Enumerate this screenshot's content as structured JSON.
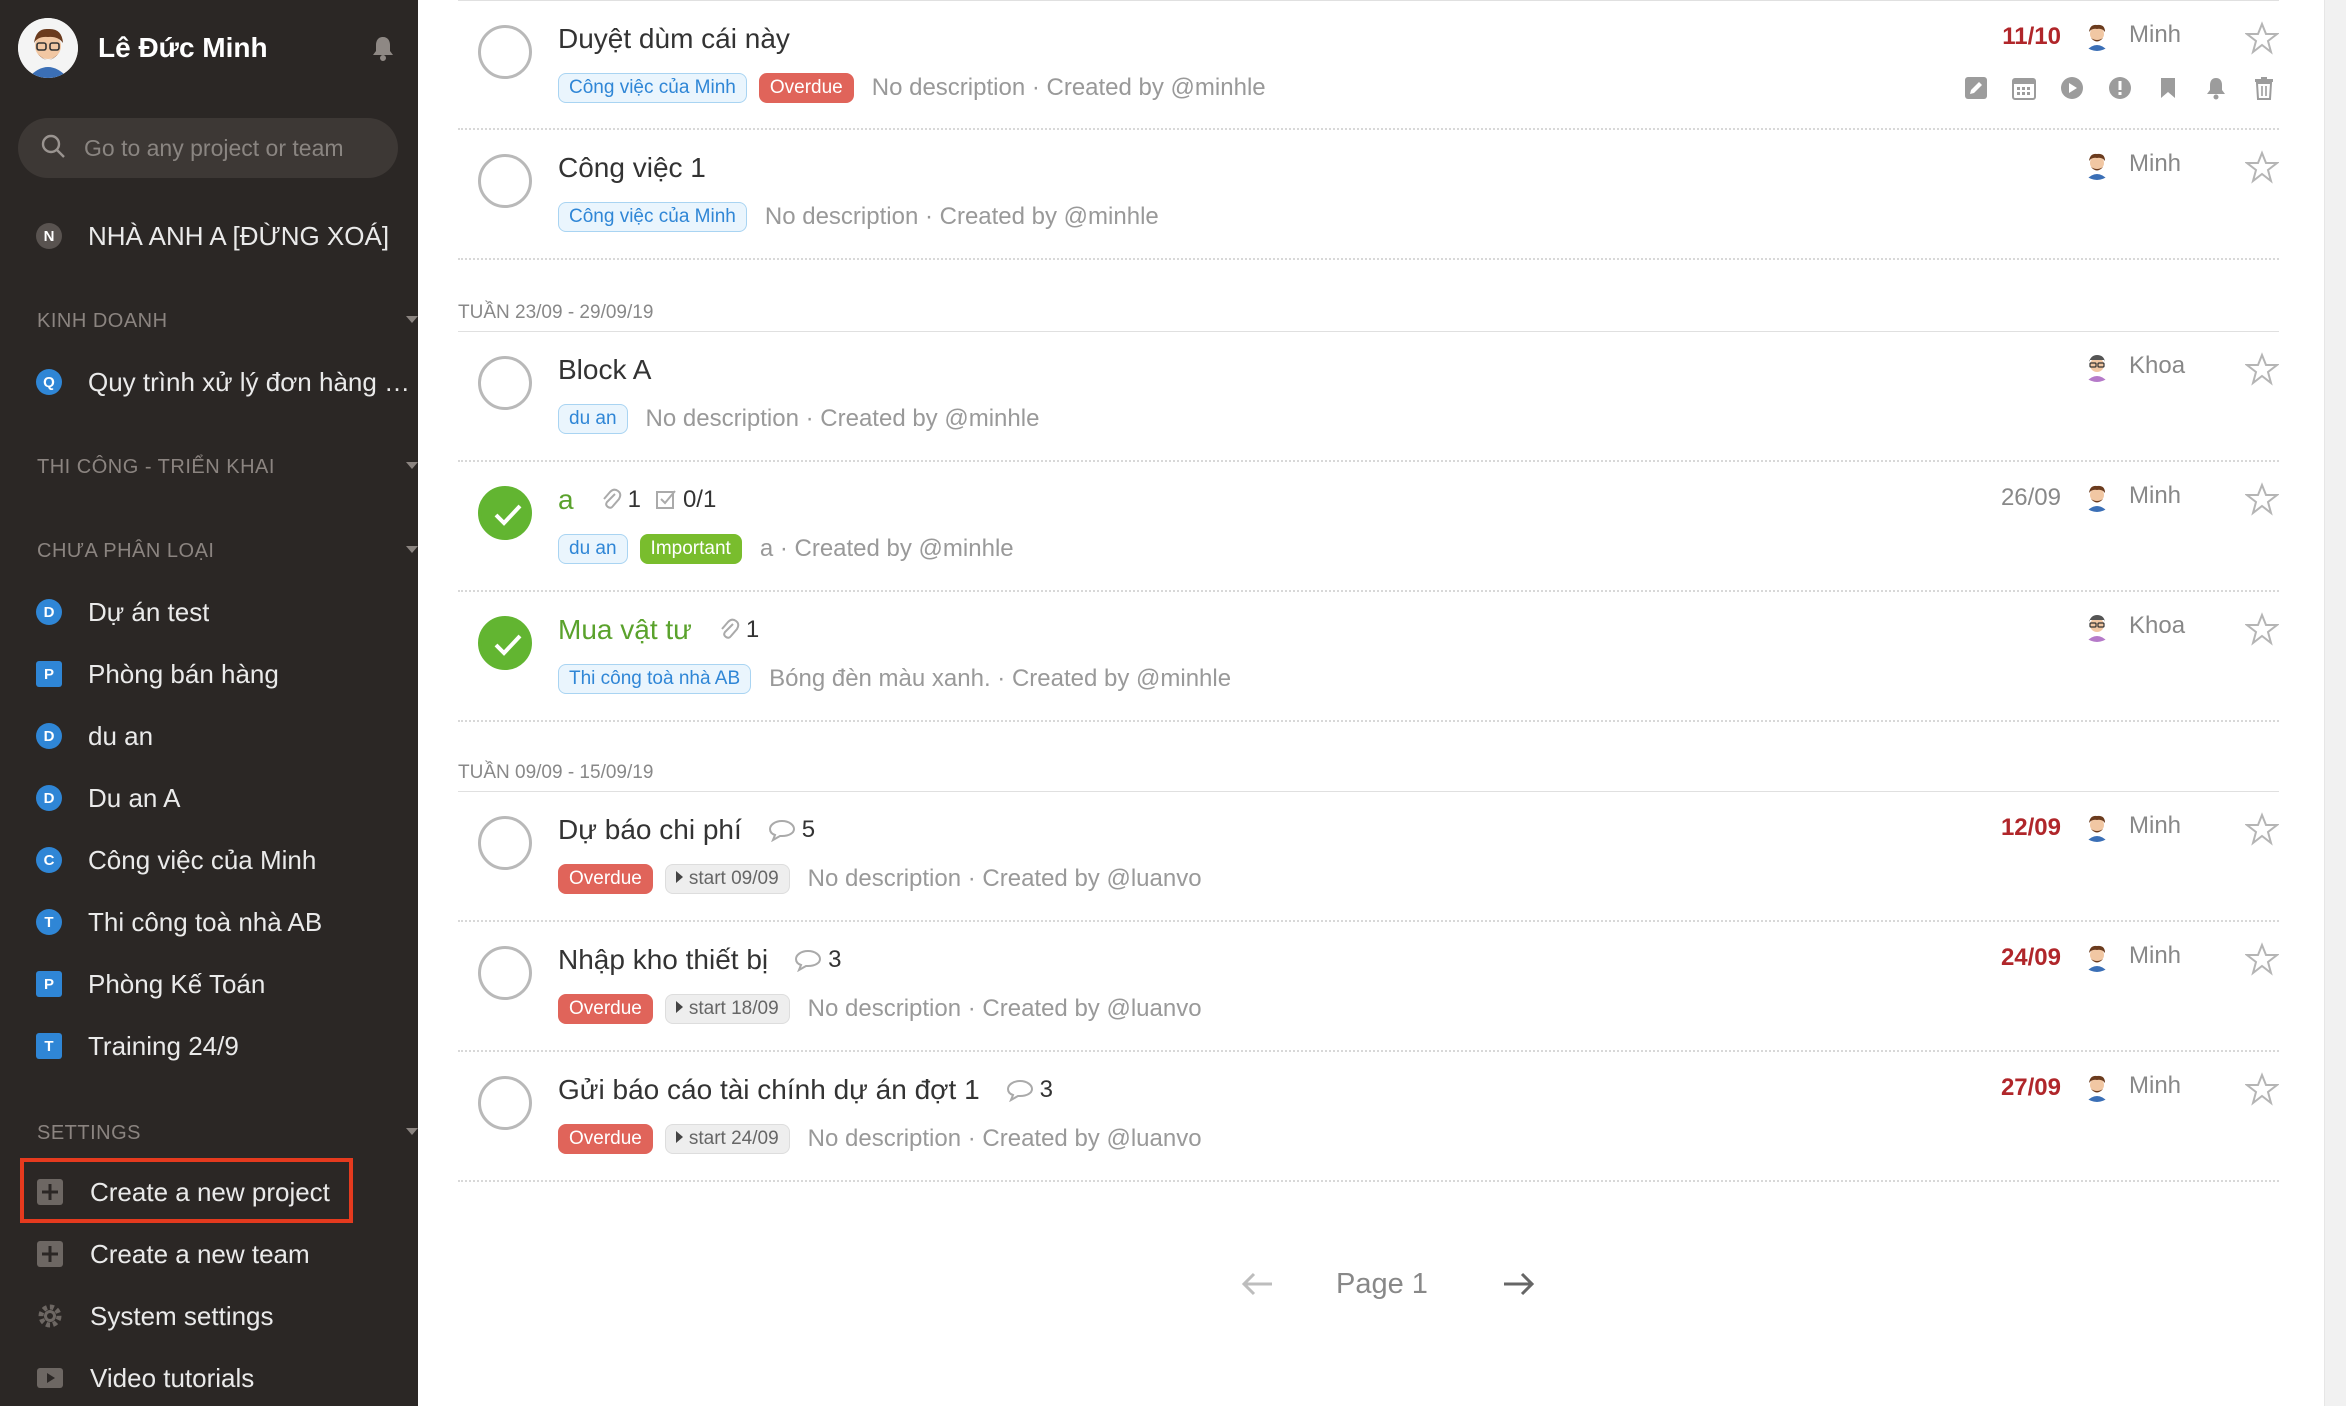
{
  "sidebar": {
    "user_name": "Lê Đức Minh",
    "search_placeholder": "Go to any project or team",
    "top_item": {
      "letter": "N",
      "label": "NHÀ ANH A [ĐỪNG XOÁ]"
    },
    "sections": [
      {
        "title": "KINH DOANH"
      },
      {
        "title": "THI CÔNG - TRIỂN KHAI"
      },
      {
        "title": "CHƯA PHÂN LOẠI"
      },
      {
        "title": "SETTINGS"
      }
    ],
    "kinh_doanh_items": [
      {
        "letter": "Q",
        "label": "Quy trình xử lý đơn hàng - Tr..."
      }
    ],
    "uncategorized_items": [
      {
        "letter": "D",
        "label": "Dự án test"
      },
      {
        "letter": "P",
        "label": "Phòng bán hàng"
      },
      {
        "letter": "D",
        "label": "du an"
      },
      {
        "letter": "D",
        "label": "Du an A"
      },
      {
        "letter": "C",
        "label": "Công việc của Minh"
      },
      {
        "letter": "T",
        "label": "Thi công toà nhà AB"
      },
      {
        "letter": "P",
        "label": "Phòng Kế Toán"
      },
      {
        "letter": "T",
        "label": "Training 24/9"
      }
    ],
    "settings_items": [
      {
        "icon": "plus-square-icon",
        "label": "Create a new project"
      },
      {
        "icon": "plus-square-icon",
        "label": "Create a new team"
      },
      {
        "icon": "gear-icon",
        "label": "System settings"
      },
      {
        "icon": "video-icon",
        "label": "Video tutorials"
      }
    ],
    "accent": "#2f86d6",
    "highlight_color": "#e53a1e"
  },
  "weeks": [
    {
      "label": "TUẦN 23/09 - 29/09/19"
    },
    {
      "label": "TUẦN 09/09 - 15/09/19"
    }
  ],
  "tasks": [
    {
      "title": "Duyệt dùm cái này",
      "done": false,
      "tags": [
        {
          "text": "Công việc của Minh",
          "style": "blue"
        },
        {
          "text": "Overdue",
          "style": "red"
        }
      ],
      "desc": "No description · Created by @minhle",
      "due": "11/10",
      "assignee": "Minh"
    },
    {
      "title": "Công việc 1",
      "done": false,
      "tags": [
        {
          "text": "Công việc của Minh",
          "style": "blue"
        }
      ],
      "desc": "No description · Created by @minhle",
      "due": "",
      "assignee": "Minh"
    },
    {
      "title": "Block A",
      "done": false,
      "tags": [
        {
          "text": "du an",
          "style": "blue"
        }
      ],
      "desc": "No description · Created by @minhle",
      "due": "",
      "assignee": "Khoa"
    },
    {
      "title": "a",
      "done": true,
      "attachments": "1",
      "checklist": "0/1",
      "tags": [
        {
          "text": "du an",
          "style": "blue"
        },
        {
          "text": "Important",
          "style": "green"
        }
      ],
      "desc": "a · Created by @minhle",
      "due": "26/09",
      "assignee": "Minh"
    },
    {
      "title": "Mua vật tư",
      "done": true,
      "attachments": "1",
      "tags": [
        {
          "text": "Thi công toà nhà AB",
          "style": "blue"
        }
      ],
      "desc": "Bóng đèn màu xanh. · Created by @minhle",
      "due": "",
      "assignee": "Khoa"
    },
    {
      "title": "Dự báo chi phí",
      "done": false,
      "comments": "5",
      "tags": [
        {
          "text": "Overdue",
          "style": "red"
        },
        {
          "text": "start 09/09",
          "style": "grey"
        }
      ],
      "desc": "No description · Created by @luanvo",
      "due": "12/09",
      "assignee": "Minh"
    },
    {
      "title": "Nhập kho thiết bị",
      "done": false,
      "comments": "3",
      "tags": [
        {
          "text": "Overdue",
          "style": "red"
        },
        {
          "text": "start 18/09",
          "style": "grey"
        }
      ],
      "desc": "No description · Created by @luanvo",
      "due": "24/09",
      "assignee": "Minh"
    },
    {
      "title": "Gửi báo cáo tài chính dự án đợt 1",
      "done": false,
      "comments": "3",
      "tags": [
        {
          "text": "Overdue",
          "style": "red"
        },
        {
          "text": "start 24/09",
          "style": "grey"
        }
      ],
      "desc": "No description · Created by @luanvo",
      "due": "27/09",
      "assignee": "Minh"
    }
  ],
  "pager": {
    "label": "Page 1"
  },
  "colors": {
    "overdue": "#e0645a",
    "done": "#62b531",
    "due_overdue": "#b0262a",
    "important": "#79bd2d"
  }
}
